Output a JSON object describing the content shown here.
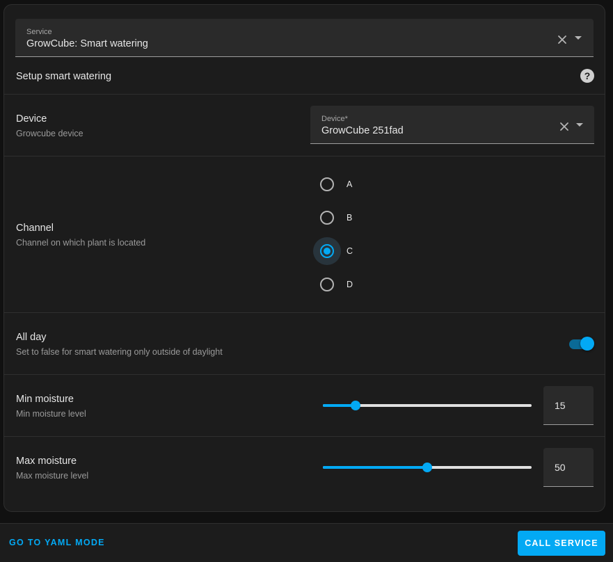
{
  "service_field": {
    "label": "Service",
    "value": "GrowCube: Smart watering"
  },
  "service_description": "Setup smart watering",
  "help_icon": "help-circle-icon",
  "device_row": {
    "title": "Device",
    "description": "Growcube device",
    "field": {
      "label": "Device*",
      "value": "GrowCube 251fad"
    }
  },
  "channel_row": {
    "title": "Channel",
    "description": "Channel on which plant is located",
    "options": [
      "A",
      "B",
      "C",
      "D"
    ],
    "selected": "C"
  },
  "all_day_row": {
    "title": "All day",
    "description": "Set to false for smart watering only outside of daylight",
    "enabled": true
  },
  "min_moisture_row": {
    "title": "Min moisture",
    "description": "Min moisture level",
    "value": "15",
    "slider_fraction": 0.155
  },
  "max_moisture_row": {
    "title": "Max moisture",
    "description": "Max moisture level",
    "value": "50",
    "slider_fraction": 0.5
  },
  "footer": {
    "yaml_mode_label": "GO TO YAML MODE",
    "call_service_label": "CALL SERVICE"
  },
  "colors": {
    "accent": "#03a9f4",
    "background": "#111111",
    "card": "#1c1c1c"
  }
}
